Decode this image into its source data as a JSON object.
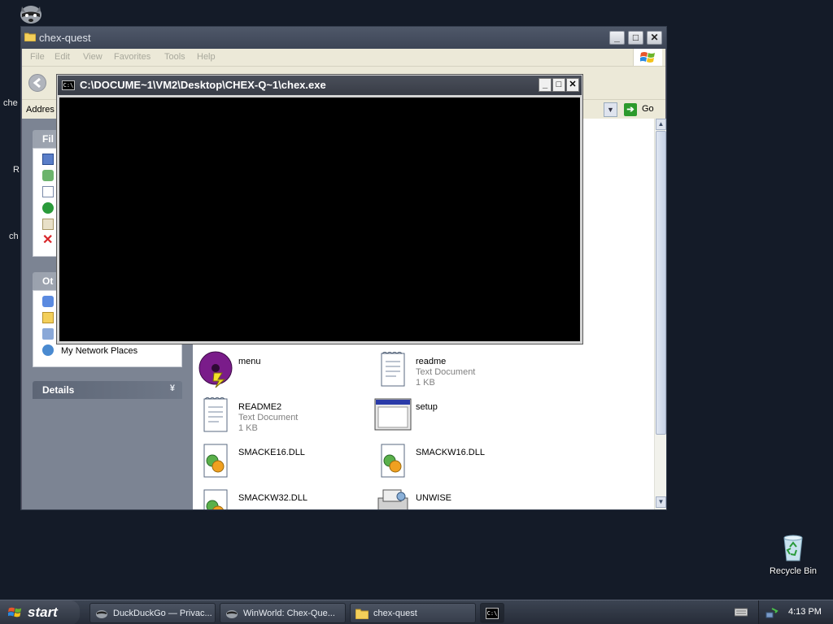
{
  "desktop": {
    "cut_labels": [
      "che",
      "R",
      "ch"
    ],
    "recycle_bin": "Recycle Bin"
  },
  "explorer": {
    "title": "chex-quest",
    "menu": [
      "File",
      "Edit",
      "View",
      "Favorites",
      "Tools",
      "Help"
    ],
    "address_label": "Addres",
    "go_label": "Go",
    "panels": {
      "file_tasks_header": "Fil",
      "other_places_header": "Ot",
      "other_places_item": "My Network Places",
      "details_header": "Details"
    },
    "files": [
      {
        "name": "menu",
        "type": "",
        "size": ""
      },
      {
        "name": "readme",
        "type": "Text Document",
        "size": "1 KB"
      },
      {
        "name": "README2",
        "type": "Text Document",
        "size": "1 KB"
      },
      {
        "name": "setup",
        "type": "",
        "size": ""
      },
      {
        "name": "SMACKE16.DLL",
        "type": "",
        "size": ""
      },
      {
        "name": "SMACKW16.DLL",
        "type": "",
        "size": ""
      },
      {
        "name": "SMACKW32.DLL",
        "type": "",
        "size": ""
      },
      {
        "name": "UNWISE",
        "type": "",
        "size": ""
      }
    ]
  },
  "console": {
    "title": "C:\\DOCUME~1\\VM2\\Desktop\\CHEX-Q~1\\chex.exe",
    "icon_text": "C:\\"
  },
  "taskbar": {
    "start_label": "start",
    "tasks": [
      {
        "label": "DuckDuckGo — Privac...",
        "icon": "firefox-icon"
      },
      {
        "label": "WinWorld: Chex-Que...",
        "icon": "firefox-icon"
      },
      {
        "label": "chex-quest",
        "icon": "folder-icon"
      },
      {
        "label": "C:\\",
        "icon": "console-icon"
      }
    ],
    "clock": "4:13 PM"
  }
}
